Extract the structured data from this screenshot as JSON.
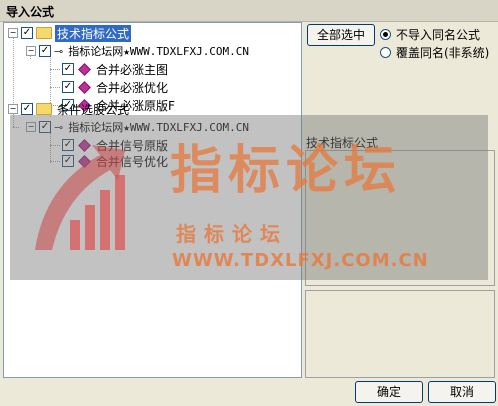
{
  "window": {
    "title": "导入公式"
  },
  "tree": {
    "group1": {
      "label": "技术指标公式",
      "child": {
        "label": "指标论坛网★WWW.TDXLFXJ.COM.CN",
        "items": [
          "合并必涨主图",
          "合并必涨优化",
          "合并必涨原版F"
        ]
      }
    },
    "group2": {
      "label": "条件选股公式",
      "child": {
        "label": "指标论坛网★WWW.TDXLFXJ.COM.CN",
        "items": [
          "合并信号原版",
          "合并信号优化"
        ]
      }
    }
  },
  "options": {
    "select_all": "全部选中",
    "radio1": "不导入同名公式",
    "radio2": "覆盖同名(非系统)"
  },
  "detail": {
    "label": "技术指标公式"
  },
  "watermark": {
    "big": "指标论坛",
    "mid": "指标论坛",
    "url": "WWW.TDXLFXJ.COM.CN"
  },
  "buttons": {
    "ok": "确定",
    "cancel": "取消"
  },
  "colors": {
    "selection": "#316ac5",
    "watermark": "#e6783c",
    "accent_border": "#003c74"
  }
}
